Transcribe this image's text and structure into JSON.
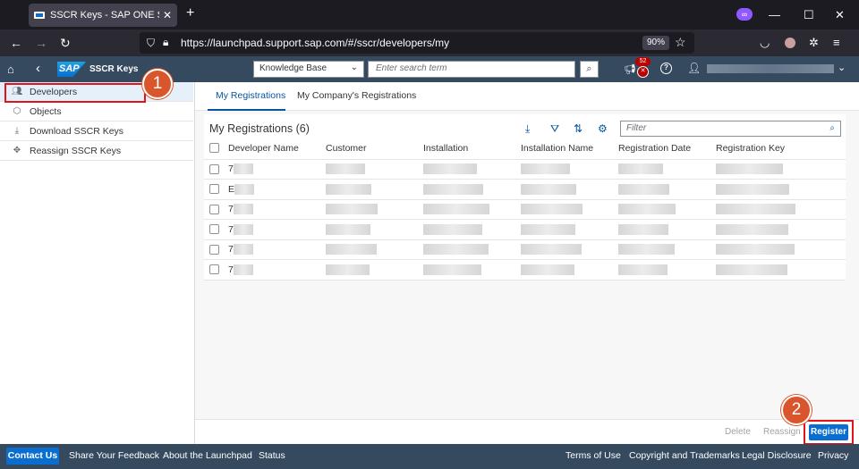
{
  "browser": {
    "tab_title": "SSCR Keys - SAP ONE Suppor",
    "new_tab": "+",
    "url": "https://launchpad.support.sap.com/#/sscr/developers/my",
    "zoom": "90%"
  },
  "shell": {
    "logo": "SAP",
    "app_title": "SSCR Keys",
    "scope": "Knowledge Base",
    "search_placeholder": "Enter search term",
    "notifications": "52"
  },
  "sidebar": {
    "items": [
      {
        "label": "Developers",
        "icon": "users-icon",
        "selected": true
      },
      {
        "label": "Objects",
        "icon": "cube-icon"
      },
      {
        "label": "Download SSCR Keys",
        "icon": "download-icon"
      },
      {
        "label": "Reassign SSCR Keys",
        "icon": "move-icon"
      }
    ]
  },
  "main": {
    "tabs": [
      {
        "label": "My Registrations",
        "active": true
      },
      {
        "label": "My Company's Registrations"
      }
    ],
    "table_title": "My Registrations",
    "count": "(6)",
    "filter_placeholder": "Filter",
    "columns": [
      "Developer Name",
      "Customer",
      "Installation",
      "Installation Name",
      "Registration Date",
      "Registration Key"
    ],
    "rows": [
      {
        "dev": "7"
      },
      {
        "dev": "E"
      },
      {
        "dev": "7"
      },
      {
        "dev": "7"
      },
      {
        "dev": "7"
      },
      {
        "dev": "7"
      }
    ]
  },
  "footer_toolbar": {
    "delete": "Delete",
    "reassign": "Reassign",
    "register": "Register"
  },
  "annotations": {
    "step1": "1",
    "step2": "2"
  },
  "bottom_bar": {
    "contact": "Contact Us",
    "feedback": "Share Your Feedback",
    "about": "About the Launchpad",
    "status": "Status",
    "terms": "Terms of Use",
    "copyright": "Copyright and Trademarks",
    "legal": "Legal Disclosure",
    "privacy": "Privacy"
  }
}
